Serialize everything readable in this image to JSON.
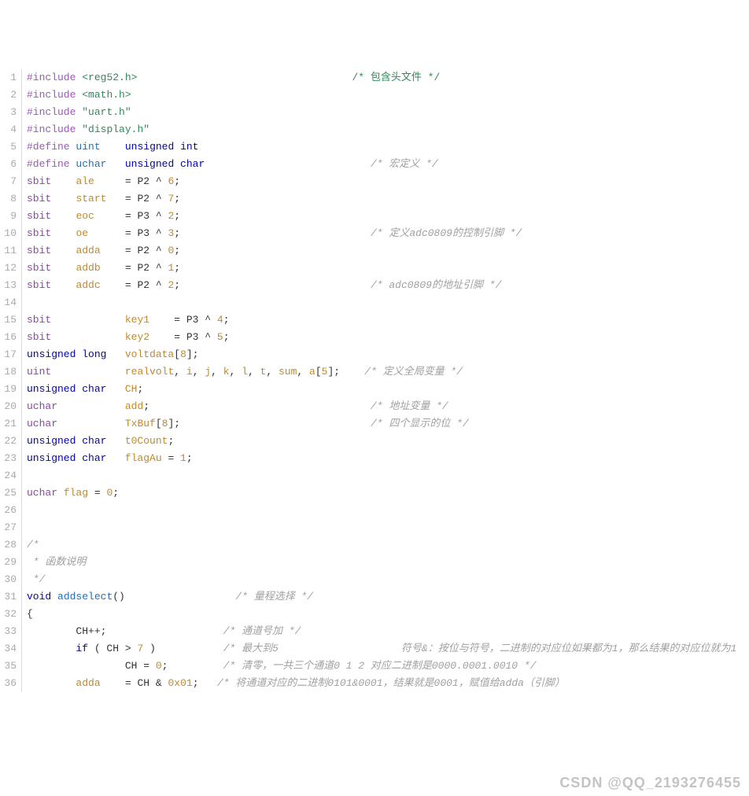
{
  "lines": [
    {
      "n": 1,
      "segs": [
        {
          "t": "#include",
          "c": "pp"
        },
        {
          "t": " ",
          "c": ""
        },
        {
          "t": "<reg52.h>",
          "c": "ang"
        },
        {
          "t": "                                   ",
          "c": ""
        },
        {
          "t": "/* 包含头文件 */",
          "c": "cm"
        }
      ]
    },
    {
      "n": 2,
      "segs": [
        {
          "t": "#include",
          "c": "pp"
        },
        {
          "t": " ",
          "c": ""
        },
        {
          "t": "<math.h>",
          "c": "ang"
        }
      ]
    },
    {
      "n": 3,
      "segs": [
        {
          "t": "#include",
          "c": "pp"
        },
        {
          "t": " ",
          "c": ""
        },
        {
          "t": "\"uart.h\"",
          "c": "str"
        }
      ]
    },
    {
      "n": 4,
      "segs": [
        {
          "t": "#include",
          "c": "pp"
        },
        {
          "t": " ",
          "c": ""
        },
        {
          "t": "\"display.h\"",
          "c": "str"
        }
      ]
    },
    {
      "n": 5,
      "segs": [
        {
          "t": "#define",
          "c": "pp"
        },
        {
          "t": " ",
          "c": ""
        },
        {
          "t": "uint",
          "c": "fn"
        },
        {
          "t": "    ",
          "c": ""
        },
        {
          "t": "unsigned int",
          "c": "kw"
        }
      ]
    },
    {
      "n": 6,
      "segs": [
        {
          "t": "#define",
          "c": "pp"
        },
        {
          "t": " ",
          "c": ""
        },
        {
          "t": "uchar",
          "c": "fn"
        },
        {
          "t": "   ",
          "c": ""
        },
        {
          "t": "unsigned char",
          "c": "kw"
        },
        {
          "t": "                           ",
          "c": ""
        },
        {
          "t": "/* 宏定义 */",
          "c": "cmg"
        }
      ]
    },
    {
      "n": 7,
      "segs": [
        {
          "t": "sbit",
          "c": "ty"
        },
        {
          "t": "    ",
          "c": ""
        },
        {
          "t": "ale",
          "c": "nm"
        },
        {
          "t": "     = P2 ^ ",
          "c": ""
        },
        {
          "t": "6",
          "c": "num"
        },
        {
          "t": ";",
          "c": ""
        }
      ]
    },
    {
      "n": 8,
      "segs": [
        {
          "t": "sbit",
          "c": "ty"
        },
        {
          "t": "    ",
          "c": ""
        },
        {
          "t": "start",
          "c": "nm"
        },
        {
          "t": "   = P2 ^ ",
          "c": ""
        },
        {
          "t": "7",
          "c": "num"
        },
        {
          "t": ";",
          "c": ""
        }
      ]
    },
    {
      "n": 9,
      "segs": [
        {
          "t": "sbit",
          "c": "ty"
        },
        {
          "t": "    ",
          "c": ""
        },
        {
          "t": "eoc",
          "c": "nm"
        },
        {
          "t": "     = P3 ^ ",
          "c": ""
        },
        {
          "t": "2",
          "c": "num"
        },
        {
          "t": ";",
          "c": ""
        }
      ]
    },
    {
      "n": 10,
      "segs": [
        {
          "t": "sbit",
          "c": "ty"
        },
        {
          "t": "    ",
          "c": ""
        },
        {
          "t": "oe",
          "c": "nm"
        },
        {
          "t": "      = P3 ^ ",
          "c": ""
        },
        {
          "t": "3",
          "c": "num"
        },
        {
          "t": ";",
          "c": ""
        },
        {
          "t": "                               ",
          "c": ""
        },
        {
          "t": "/* 定义adc0809的控制引脚 */",
          "c": "cmg"
        }
      ]
    },
    {
      "n": 11,
      "segs": [
        {
          "t": "sbit",
          "c": "ty"
        },
        {
          "t": "    ",
          "c": ""
        },
        {
          "t": "adda",
          "c": "nm"
        },
        {
          "t": "    = P2 ^ ",
          "c": ""
        },
        {
          "t": "0",
          "c": "num"
        },
        {
          "t": ";",
          "c": ""
        }
      ]
    },
    {
      "n": 12,
      "segs": [
        {
          "t": "sbit",
          "c": "ty"
        },
        {
          "t": "    ",
          "c": ""
        },
        {
          "t": "addb",
          "c": "nm"
        },
        {
          "t": "    = P2 ^ ",
          "c": ""
        },
        {
          "t": "1",
          "c": "num"
        },
        {
          "t": ";",
          "c": ""
        }
      ]
    },
    {
      "n": 13,
      "segs": [
        {
          "t": "sbit",
          "c": "ty"
        },
        {
          "t": "    ",
          "c": ""
        },
        {
          "t": "addc",
          "c": "nm"
        },
        {
          "t": "    = P2 ^ ",
          "c": ""
        },
        {
          "t": "2",
          "c": "num"
        },
        {
          "t": ";",
          "c": ""
        },
        {
          "t": "                               ",
          "c": ""
        },
        {
          "t": "/* adc0809的地址引脚 */",
          "c": "cmg"
        }
      ]
    },
    {
      "n": 14,
      "segs": [
        {
          "t": " ",
          "c": ""
        }
      ]
    },
    {
      "n": 15,
      "segs": [
        {
          "t": "sbit",
          "c": "ty"
        },
        {
          "t": "            ",
          "c": ""
        },
        {
          "t": "key1",
          "c": "nm"
        },
        {
          "t": "    = P3 ^ ",
          "c": ""
        },
        {
          "t": "4",
          "c": "num"
        },
        {
          "t": ";",
          "c": ""
        }
      ]
    },
    {
      "n": 16,
      "segs": [
        {
          "t": "sbit",
          "c": "ty"
        },
        {
          "t": "            ",
          "c": ""
        },
        {
          "t": "key2",
          "c": "nm"
        },
        {
          "t": "    = P3 ^ ",
          "c": ""
        },
        {
          "t": "5",
          "c": "num"
        },
        {
          "t": ";",
          "c": ""
        }
      ]
    },
    {
      "n": 17,
      "segs": [
        {
          "t": "unsigned long",
          "c": "kw"
        },
        {
          "t": "   ",
          "c": ""
        },
        {
          "t": "voltdata",
          "c": "nm"
        },
        {
          "t": "[",
          "c": ""
        },
        {
          "t": "8",
          "c": "num"
        },
        {
          "t": "];",
          "c": ""
        }
      ]
    },
    {
      "n": 18,
      "segs": [
        {
          "t": "uint",
          "c": "ty"
        },
        {
          "t": "            ",
          "c": ""
        },
        {
          "t": "realvolt",
          "c": "nm"
        },
        {
          "t": ", ",
          "c": ""
        },
        {
          "t": "i",
          "c": "nm"
        },
        {
          "t": ", ",
          "c": ""
        },
        {
          "t": "j",
          "c": "nm"
        },
        {
          "t": ", ",
          "c": ""
        },
        {
          "t": "k",
          "c": "nm"
        },
        {
          "t": ", ",
          "c": ""
        },
        {
          "t": "l",
          "c": "nm"
        },
        {
          "t": ", ",
          "c": ""
        },
        {
          "t": "t",
          "c": "nm"
        },
        {
          "t": ", ",
          "c": ""
        },
        {
          "t": "sum",
          "c": "nm"
        },
        {
          "t": ", ",
          "c": ""
        },
        {
          "t": "a",
          "c": "nm"
        },
        {
          "t": "[",
          "c": ""
        },
        {
          "t": "5",
          "c": "num"
        },
        {
          "t": "];",
          "c": ""
        },
        {
          "t": "    ",
          "c": ""
        },
        {
          "t": "/* 定义全局变量 */",
          "c": "cmg"
        }
      ]
    },
    {
      "n": 19,
      "segs": [
        {
          "t": "unsigned char",
          "c": "kw"
        },
        {
          "t": "   ",
          "c": ""
        },
        {
          "t": "CH",
          "c": "nm"
        },
        {
          "t": ";",
          "c": ""
        }
      ]
    },
    {
      "n": 20,
      "segs": [
        {
          "t": "uchar",
          "c": "ty"
        },
        {
          "t": "           ",
          "c": ""
        },
        {
          "t": "add",
          "c": "nm"
        },
        {
          "t": ";",
          "c": ""
        },
        {
          "t": "                                    ",
          "c": ""
        },
        {
          "t": "/* 地址变量 */",
          "c": "cmg"
        }
      ]
    },
    {
      "n": 21,
      "segs": [
        {
          "t": "uchar",
          "c": "ty"
        },
        {
          "t": "           ",
          "c": ""
        },
        {
          "t": "TxBuf",
          "c": "nm"
        },
        {
          "t": "[",
          "c": ""
        },
        {
          "t": "8",
          "c": "num"
        },
        {
          "t": "];",
          "c": ""
        },
        {
          "t": "                               ",
          "c": ""
        },
        {
          "t": "/* 四个显示的位 */",
          "c": "cmg"
        }
      ]
    },
    {
      "n": 22,
      "segs": [
        {
          "t": "unsigned char",
          "c": "kw"
        },
        {
          "t": "   ",
          "c": ""
        },
        {
          "t": "t0Count",
          "c": "nm"
        },
        {
          "t": ";",
          "c": ""
        }
      ]
    },
    {
      "n": 23,
      "segs": [
        {
          "t": "unsigned char",
          "c": "kw"
        },
        {
          "t": "   ",
          "c": ""
        },
        {
          "t": "flagAu",
          "c": "nm"
        },
        {
          "t": " = ",
          "c": ""
        },
        {
          "t": "1",
          "c": "num"
        },
        {
          "t": ";",
          "c": ""
        }
      ]
    },
    {
      "n": 24,
      "segs": [
        {
          "t": " ",
          "c": ""
        }
      ]
    },
    {
      "n": 25,
      "segs": [
        {
          "t": "uchar",
          "c": "ty"
        },
        {
          "t": " ",
          "c": ""
        },
        {
          "t": "flag",
          "c": "nm"
        },
        {
          "t": " = ",
          "c": ""
        },
        {
          "t": "0",
          "c": "num"
        },
        {
          "t": ";",
          "c": ""
        }
      ]
    },
    {
      "n": 26,
      "segs": [
        {
          "t": " ",
          "c": ""
        }
      ]
    },
    {
      "n": 27,
      "segs": [
        {
          "t": " ",
          "c": ""
        }
      ]
    },
    {
      "n": 28,
      "segs": [
        {
          "t": "/*",
          "c": "cmg"
        }
      ]
    },
    {
      "n": 29,
      "segs": [
        {
          "t": " * 函数说明",
          "c": "cmg"
        }
      ]
    },
    {
      "n": 30,
      "segs": [
        {
          "t": " */",
          "c": "cmg"
        }
      ]
    },
    {
      "n": 31,
      "segs": [
        {
          "t": "void",
          "c": "kw"
        },
        {
          "t": " ",
          "c": ""
        },
        {
          "t": "addselect",
          "c": "fn"
        },
        {
          "t": "()",
          "c": ""
        },
        {
          "t": "                  ",
          "c": ""
        },
        {
          "t": "/* 量程选择 */",
          "c": "cmg"
        }
      ]
    },
    {
      "n": 32,
      "segs": [
        {
          "t": "{",
          "c": ""
        }
      ]
    },
    {
      "n": 33,
      "segs": [
        {
          "t": "        CH++;",
          "c": ""
        },
        {
          "t": "                   ",
          "c": ""
        },
        {
          "t": "/* 通道号加 */",
          "c": "cmg"
        }
      ]
    },
    {
      "n": 34,
      "segs": [
        {
          "t": "        ",
          "c": ""
        },
        {
          "t": "if",
          "c": "kw"
        },
        {
          "t": " ( CH > ",
          "c": ""
        },
        {
          "t": "7",
          "c": "num"
        },
        {
          "t": " )",
          "c": ""
        },
        {
          "t": "           ",
          "c": ""
        },
        {
          "t": "/* 最大到5                    符号&：按位与符号，二进制的对应位如果都为1，那么结果的对应位就为1",
          "c": "cmg"
        }
      ]
    },
    {
      "n": 35,
      "segs": [
        {
          "t": "                CH = ",
          "c": ""
        },
        {
          "t": "0",
          "c": "num"
        },
        {
          "t": ";",
          "c": ""
        },
        {
          "t": "         ",
          "c": ""
        },
        {
          "t": "/* 清零，一共三个通道0 1 2 对应二进制是0000.0001.0010 */",
          "c": "cmg"
        }
      ]
    },
    {
      "n": 36,
      "segs": [
        {
          "t": "        ",
          "c": ""
        },
        {
          "t": "adda",
          "c": "nm"
        },
        {
          "t": "    = CH & ",
          "c": ""
        },
        {
          "t": "0x01",
          "c": "num"
        },
        {
          "t": ";",
          "c": ""
        },
        {
          "t": "   ",
          "c": ""
        },
        {
          "t": "/* 将通道对应的二进制0101&0001，结果就是0001，赋值给adda（引脚）",
          "c": "cmg"
        }
      ]
    }
  ],
  "watermark": "CSDN @QQ_2193276455"
}
